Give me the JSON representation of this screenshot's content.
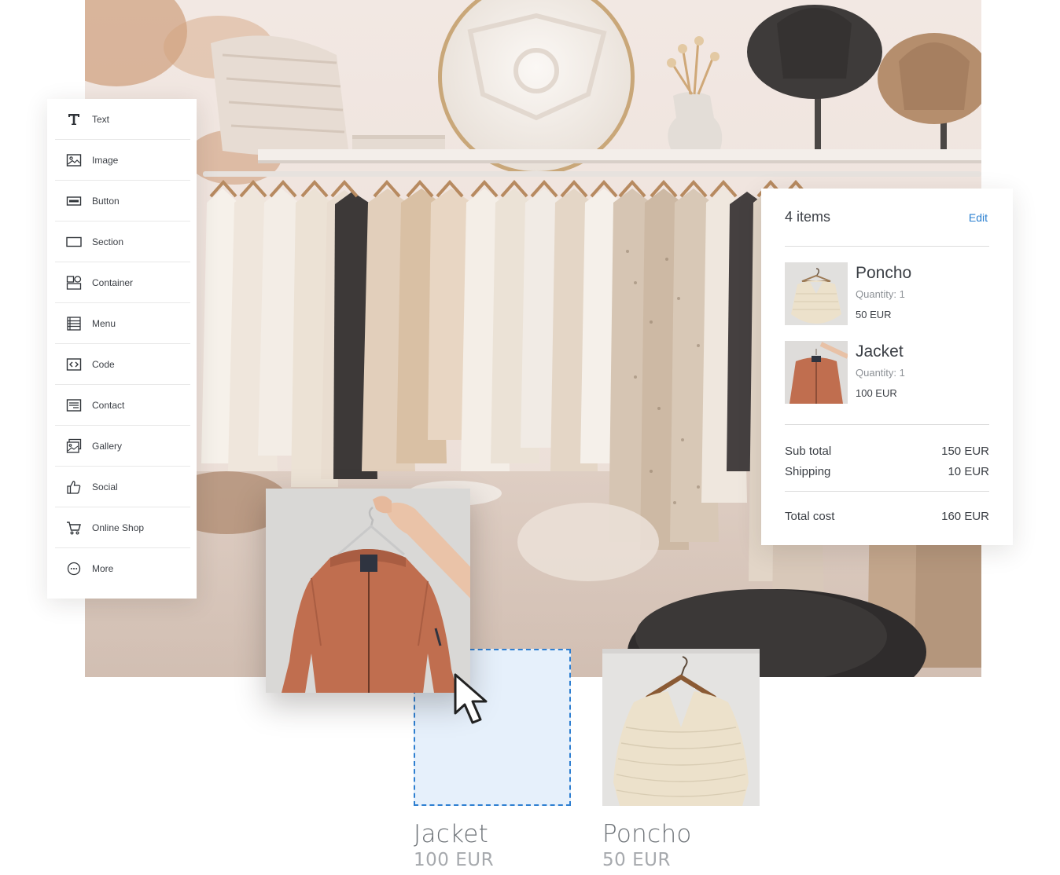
{
  "sidebar": {
    "items": [
      {
        "label": "Text",
        "icon": "text-icon"
      },
      {
        "label": "Image",
        "icon": "image-icon"
      },
      {
        "label": "Button",
        "icon": "button-icon"
      },
      {
        "label": "Section",
        "icon": "section-icon"
      },
      {
        "label": "Container",
        "icon": "container-icon"
      },
      {
        "label": "Menu",
        "icon": "menu-icon"
      },
      {
        "label": "Code",
        "icon": "code-icon"
      },
      {
        "label": "Contact",
        "icon": "contact-icon"
      },
      {
        "label": "Gallery",
        "icon": "gallery-icon"
      },
      {
        "label": "Social",
        "icon": "thumbs-up-icon"
      },
      {
        "label": "Online Shop",
        "icon": "cart-icon"
      },
      {
        "label": "More",
        "icon": "more-icon"
      }
    ]
  },
  "cart": {
    "count_label": "4 items",
    "edit_label": "Edit",
    "items": [
      {
        "name": "Poncho",
        "quantity": "Quantity: 1",
        "price": "50 EUR"
      },
      {
        "name": "Jacket",
        "quantity": "Quantity: 1",
        "price": "100 EUR"
      }
    ],
    "subtotal_label": "Sub total",
    "subtotal_value": "150 EUR",
    "shipping_label": "Shipping",
    "shipping_value": "10 EUR",
    "total_label": "Total cost",
    "total_value": "160 EUR"
  },
  "products": [
    {
      "name": "Jacket",
      "price": "100 EUR"
    },
    {
      "name": "Poncho",
      "price": "50 EUR"
    }
  ],
  "colors": {
    "accent": "#2a7fd0",
    "drop_zone_fill": "#e6f0fb",
    "drop_zone_border": "#2e7fd1",
    "jacket": "#c06e4f",
    "poncho": "#ece1cb"
  }
}
